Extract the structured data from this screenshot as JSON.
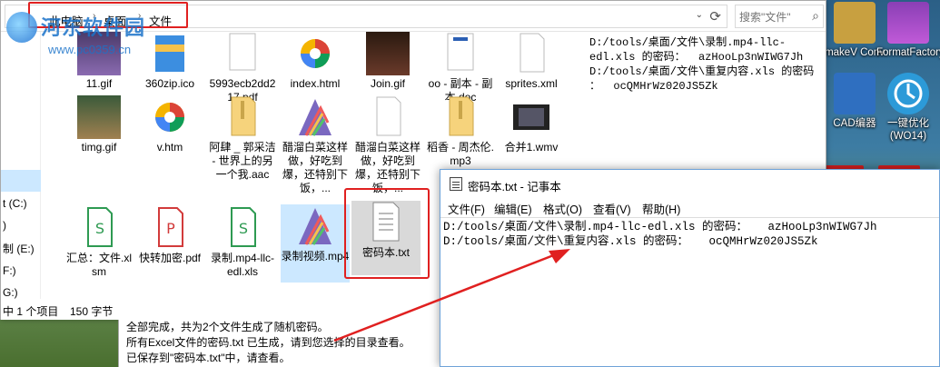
{
  "watermark": {
    "text": "河东软件园",
    "url": "www.pc0359.cn"
  },
  "explorer": {
    "breadcrumb": [
      "此电脑",
      "桌面",
      "文件"
    ],
    "search_placeholder": "搜索\"文件\"",
    "nav_items": [
      "t (C:)",
      ")",
      "制 (E:)",
      "F:)",
      "G:)"
    ],
    "files": [
      {
        "name": "11.gif",
        "icon": "image-thumb-icon"
      },
      {
        "name": "360zip.ico",
        "icon": "zip-icon"
      },
      {
        "name": "5993ecb2dd217.pdf",
        "icon": "pdf-icon"
      },
      {
        "name": "index.html",
        "icon": "html-icon"
      },
      {
        "name": "Join.gif",
        "icon": "image-thumb-icon"
      },
      {
        "name": "oo - 副本 - 副本.doc",
        "icon": "doc-icon"
      },
      {
        "name": "sprites.xml",
        "icon": "blank-file-icon"
      },
      {
        "name": "timg.gif",
        "icon": "image-thumb-icon"
      },
      {
        "name": "v.htm",
        "icon": "html-icon"
      },
      {
        "name": "阿肆 _ 郭采洁 - 世界上的另一个我.aac",
        "icon": "audio-file-icon"
      },
      {
        "name": "醋溜白菜这样做，好吃到爆，还特别下饭，...",
        "icon": "media-icon"
      },
      {
        "name": "醋溜白菜这样做，好吃到爆，还特别下饭，...",
        "icon": "blank-file-icon"
      },
      {
        "name": "稻香 - 周杰伦.mp3",
        "icon": "audio-file-icon"
      },
      {
        "name": "合并1.wmv",
        "icon": "video-icon"
      },
      {
        "name": "汇总：文件.xlsm",
        "icon": "spreadsheet-icon"
      },
      {
        "name": "快转加密.pdf",
        "icon": "pdf-icon"
      },
      {
        "name": "录制.mp4-llc-edl.xls",
        "icon": "spreadsheet-icon"
      },
      {
        "name": "录制视频.mp4",
        "icon": "media-icon"
      },
      {
        "name": "密码本.txt",
        "icon": "text-file-icon"
      }
    ],
    "preview_text": "D:/tools/桌面/文件\\录制.mp4-llc-\nedl.xls 的密码：  azHooLp3nWIWG7Jh\nD:/tools/桌面/文件\\重复内容.xls 的密码\n：  ocQMHrWz020JS5Zk",
    "status": {
      "selection": "中 1 个项目",
      "size": "150 字节"
    }
  },
  "tool_log": [
    "全部完成，共为2个文件生成了随机密码。",
    "所有Excel文件的密码.txt 已生成，请到您选择的目录查看。",
    "已保存到\"密码本.txt\"中，请查看。"
  ],
  "desktop_icons": [
    {
      "label": "makeV Conv",
      "icon": "app-icon"
    },
    {
      "label": "FormatFactory.rar",
      "icon": "archive-icon"
    },
    {
      "label": "CAD编器",
      "icon": "cad-icon"
    },
    {
      "label": "一键优化 (WO14)",
      "icon": "optimize-icon"
    }
  ],
  "notepad": {
    "title": "密码本.txt - 记事本",
    "menu": [
      "文件(F)",
      "编辑(E)",
      "格式(O)",
      "查看(V)",
      "帮助(H)"
    ],
    "lines": [
      "D:/tools/桌面/文件\\录制.mp4-llc-edl.xls 的密码：   azHooLp3nWIWG7Jh",
      "D:/tools/桌面/文件\\重复内容.xls 的密码：   ocQMHrWz020JS5Zk"
    ]
  },
  "colors": {
    "highlight_red": "#e02020",
    "selection_blue": "#cce8ff",
    "hover_gray": "#d9d9d9"
  }
}
